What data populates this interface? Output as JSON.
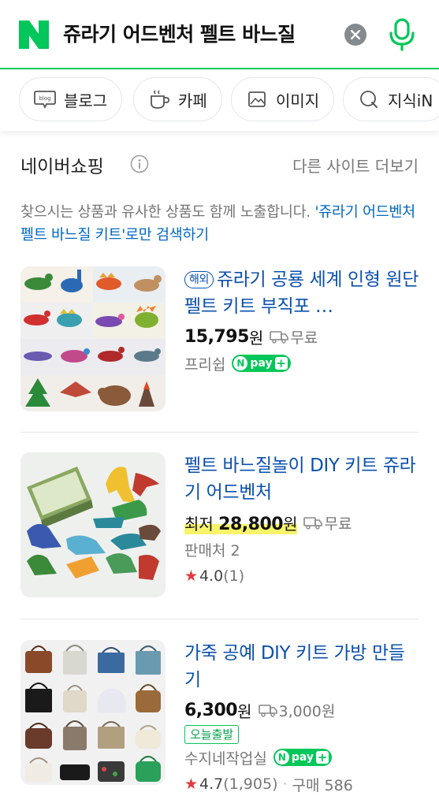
{
  "search": {
    "query": "쥬라기 어드벤처 펠트 바느질",
    "clear_label": "검색어 삭제",
    "voice_label": "음성 검색"
  },
  "tabs": [
    {
      "label": "블로그",
      "icon": "blog-icon"
    },
    {
      "label": "카페",
      "icon": "cafe-icon"
    },
    {
      "label": "이미지",
      "icon": "image-icon"
    },
    {
      "label": "지식iN",
      "icon": "knowledge-icon"
    }
  ],
  "shopping": {
    "title": "네이버쇼핑",
    "more": "다른 사이트 더보기",
    "notice_text": "찾으시는 상품과 유사한 상품도 함께 노출합니다. ",
    "notice_link": "'쥬라기 어드벤처 펠트 바느질 키트'로만 검색하기"
  },
  "products": [
    {
      "badge": "해외",
      "title": "쥬라기 공룡 세계 인형 원단 펠트 키트 부직포 …",
      "price": "15,795",
      "price_prefix": "",
      "currency": "원",
      "shipping": "무료",
      "seller": "프리쉽",
      "npay": "pay"
    },
    {
      "badge": "",
      "title": "펠트 바느질놀이 DIY 키트 쥬라기 어드벤처",
      "price_prefix": "최저 ",
      "price": "28,800",
      "currency": "원",
      "shipping": "무료",
      "seller": "판매처 2",
      "rating": "4.0",
      "reviews": "(1)"
    },
    {
      "badge": "",
      "title": "가죽 공예 DIY 키트 가방 만들기",
      "price": "6,300",
      "currency": "원",
      "shipping": "3,000원",
      "tag": "오늘출발",
      "seller": "수지네작업실",
      "npay": "pay",
      "rating": "4.7",
      "reviews": "(1,905)",
      "purchases": "구매 586"
    }
  ],
  "colors": {
    "brand": "#03c75a",
    "link": "#0b50ad",
    "highlight": "#f7f36b"
  }
}
